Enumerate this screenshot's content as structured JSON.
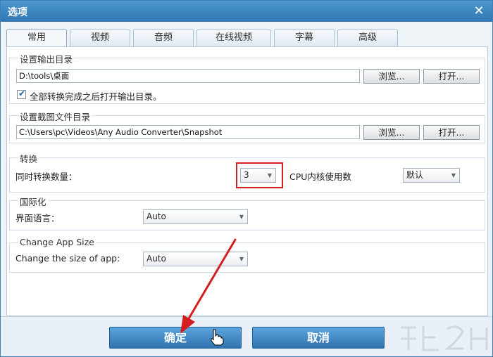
{
  "window": {
    "title": "选项",
    "close_glyph": "✕"
  },
  "tabs": [
    {
      "label": "常用",
      "active": true
    },
    {
      "label": "视频",
      "active": false
    },
    {
      "label": "音频",
      "active": false
    },
    {
      "label": "在线视频",
      "active": false
    },
    {
      "label": "字幕",
      "active": false
    },
    {
      "label": "高级",
      "active": false
    }
  ],
  "output_dir": {
    "title": "设置输出目录",
    "path": "D:\\tools\\桌面",
    "browse_label": "浏览...",
    "open_label": "打开...",
    "open_after_label": "全部转换完成之后打开输出目录。",
    "open_after_checked": true
  },
  "snapshot_dir": {
    "title": "设置截图文件目录",
    "path": "C:\\Users\\pc\\Videos\\Any Audio Converter\\Snapshot",
    "browse_label": "浏览...",
    "open_label": "打开..."
  },
  "convert": {
    "title": "转换",
    "simultaneous_label": "同时转换数量：",
    "simultaneous_value": "3",
    "cpu_label": "CPU内核使用数",
    "cpu_value": "默认"
  },
  "i18n": {
    "title": "国际化",
    "language_label": "界面语言：",
    "language_value": "Auto"
  },
  "app_size": {
    "title": "Change App Size",
    "size_label": "Change the size of app:",
    "size_value": "Auto"
  },
  "footer": {
    "ok_label": "确定",
    "cancel_label": "取消"
  },
  "colors": {
    "title_bar": "#2f77b3",
    "primary_button": "#2f74b0",
    "highlight": "#d31f1f",
    "annotation_arrow": "#d31f1f"
  }
}
